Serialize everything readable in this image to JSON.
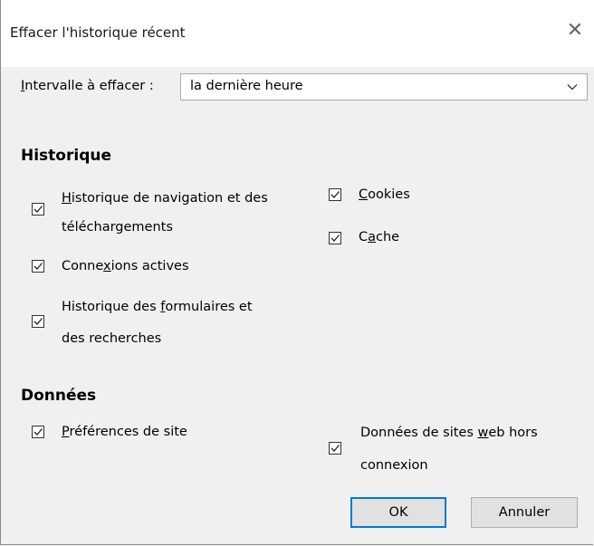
{
  "window": {
    "title": "Effacer l'historique récent",
    "close_glyph": "✕"
  },
  "range": {
    "label_mnemonic": "I",
    "label_rest": "ntervalle à effacer :",
    "selected": "la dernière heure",
    "chevron_icon": "chevron-down-icon"
  },
  "history": {
    "heading": "Historique",
    "items": [
      {
        "line1_pre": "",
        "mnemonic": "H",
        "line1_post": "istorique de navigation et des",
        "line2": "téléchargements",
        "checked": true
      },
      {
        "line1_pre": "Conne",
        "mnemonic": "x",
        "line1_post": "ions actives",
        "line2": "",
        "checked": true
      },
      {
        "line1_pre": "Historique des ",
        "mnemonic": "f",
        "line1_post": "ormulaires et",
        "line2": "des recherches",
        "checked": true
      },
      {
        "line1_pre": "",
        "mnemonic": "C",
        "line1_post": "ookies",
        "line2": "",
        "checked": true
      },
      {
        "line1_pre": "C",
        "mnemonic": "a",
        "line1_post": "che",
        "line2": "",
        "checked": true
      }
    ]
  },
  "data": {
    "heading": "Données",
    "items": [
      {
        "line1_pre": "",
        "mnemonic": "P",
        "line1_post": "références de site",
        "line2": "",
        "checked": true
      },
      {
        "line1_pre": "Données de sites ",
        "mnemonic": "w",
        "line1_post": "eb hors",
        "line2": "connexion",
        "checked": true
      }
    ]
  },
  "buttons": {
    "ok": "OK",
    "cancel": "Annuler"
  }
}
